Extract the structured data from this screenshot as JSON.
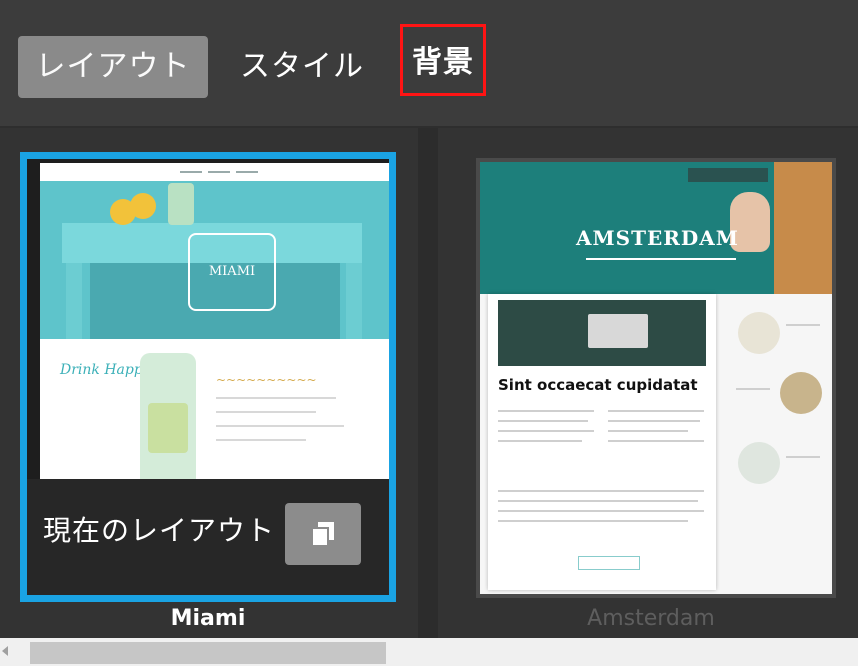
{
  "tabs": {
    "layout_label": "レイアウト",
    "style_label": "スタイル",
    "background_label": "背景"
  },
  "templates": [
    {
      "name": "Miami",
      "current_label": "現在のレイアウト",
      "logo_text": "MIAMI",
      "script_text": "Drink Happiness"
    },
    {
      "name": "Amsterdam",
      "hero_title": "AMSTERDAM",
      "post_title": "Sint occaecat cupidatat"
    }
  ],
  "colors": {
    "selected_border": "#1aa3e3",
    "highlight_box": "#ff1414",
    "active_tab": "#8a8a8a"
  },
  "icons": {
    "copy": "copy-icon",
    "scroll_left": "arrow-left-icon"
  }
}
